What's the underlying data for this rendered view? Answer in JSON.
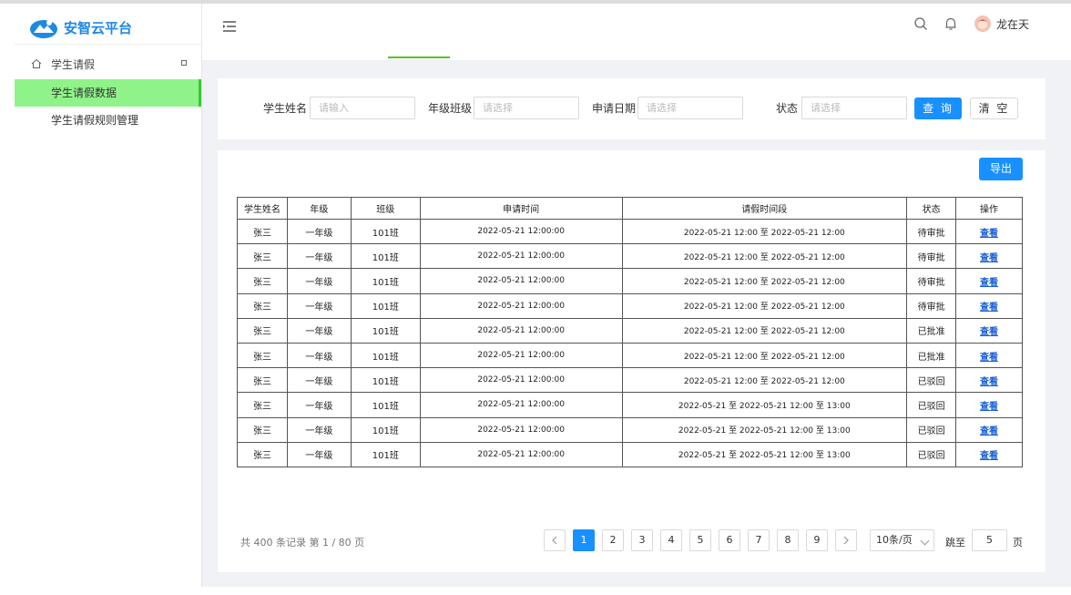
{
  "app": {
    "title": "安智云平台",
    "user_name": "龙在天"
  },
  "sidebar": {
    "group_label": "学生请假",
    "items": [
      {
        "label": "学生请假数据",
        "active": true
      },
      {
        "label": "学生请假规则管理",
        "active": false
      }
    ]
  },
  "filters": {
    "name_label": "学生姓名",
    "name_placeholder": "请输入",
    "class_label": "年级班级",
    "class_placeholder": "请选择",
    "date_label": "申请日期",
    "date_placeholder": "请选择",
    "status_label": "状态",
    "status_placeholder": "请选择",
    "query_label": "查 询",
    "clear_label": "清 空"
  },
  "toolbar": {
    "export_label": "导出"
  },
  "table": {
    "columns": [
      "学生姓名",
      "年级",
      "班级",
      "申请时间",
      "请假时间段",
      "状态",
      "操作"
    ],
    "rows": [
      [
        "张三",
        "一年级",
        "101班",
        "2022-05-21 12:00:00",
        "2022-05-21 12:00 至 2022-05-21 12:00",
        "待审批",
        "查看"
      ],
      [
        "张三",
        "一年级",
        "101班",
        "2022-05-21 12:00:00",
        "2022-05-21 12:00 至 2022-05-21 12:00",
        "待审批",
        "查看"
      ],
      [
        "张三",
        "一年级",
        "101班",
        "2022-05-21 12:00:00",
        "2022-05-21 12:00 至 2022-05-21 12:00",
        "待审批",
        "查看"
      ],
      [
        "张三",
        "一年级",
        "101班",
        "2022-05-21 12:00:00",
        "2022-05-21 12:00 至 2022-05-21 12:00",
        "待审批",
        "查看"
      ],
      [
        "张三",
        "一年级",
        "101班",
        "2022-05-21 12:00:00",
        "2022-05-21 12:00 至 2022-05-21 12:00",
        "已批准",
        "查看"
      ],
      [
        "张三",
        "一年级",
        "101班",
        "2022-05-21 12:00:00",
        "2022-05-21 12:00 至 2022-05-21 12:00",
        "已批准",
        "查看"
      ],
      [
        "张三",
        "一年级",
        "101班",
        "2022-05-21 12:00:00",
        "2022-05-21 12:00 至 2022-05-21 12:00",
        "已驳回",
        "查看"
      ],
      [
        "张三",
        "一年级",
        "101班",
        "2022-05-21 12:00:00",
        "2022-05-21 至 2022-05-21 12:00 至 13:00",
        "已驳回",
        "查看"
      ],
      [
        "张三",
        "一年级",
        "101班",
        "2022-05-21 12:00:00",
        "2022-05-21 至 2022-05-21 12:00 至 13:00",
        "已驳回",
        "查看"
      ],
      [
        "张三",
        "一年级",
        "101班",
        "2022-05-21 12:00:00",
        "2022-05-21 至 2022-05-21 12:00 至 13:00",
        "已驳回",
        "查看"
      ]
    ]
  },
  "pagination": {
    "summary": "共 400 条记录 第 1 / 80 页",
    "pages": [
      "1",
      "2",
      "3",
      "4",
      "5",
      "6",
      "7",
      "8",
      "9"
    ],
    "current": "1",
    "page_size": "10条/页",
    "jump_label": "跳至",
    "jump_value": "5",
    "page_unit": "页"
  },
  "colors": {
    "primary": "#1890ff",
    "active_menu": "#8ff38a",
    "link": "#1a5fd6"
  }
}
